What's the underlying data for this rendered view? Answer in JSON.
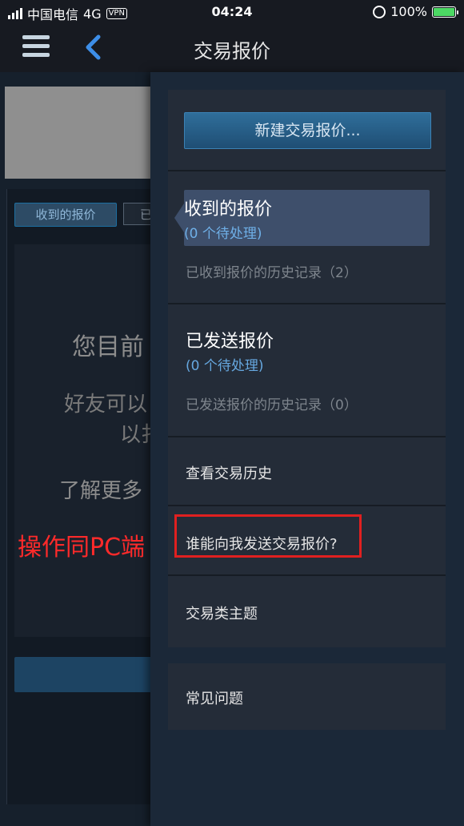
{
  "status_bar": {
    "carrier": "中国电信",
    "network": "4G",
    "vpn": "VPN",
    "time": "04:24",
    "battery_percent": "100%",
    "battery_level": 1.0,
    "battery_color": "#4cd964"
  },
  "header": {
    "title": "交易报价",
    "menu_icon": "hamburger-menu-icon",
    "back_icon": "chevron-left-icon",
    "back_color": "#3d8ee8"
  },
  "background_page": {
    "tab_received": "收到的报价",
    "tab_sent": "已",
    "text_line1": "您目前",
    "text_line2": "好友可以",
    "text_line3": "以扌",
    "text_line4": "了解更多"
  },
  "drawer": {
    "new_offer_button": "新建交易报价...",
    "received": {
      "title": "收到的报价",
      "pending": "(0 个待处理)",
      "history": "已收到报价的历史记录（2）"
    },
    "sent": {
      "title": "已发送报价",
      "pending": "(0 个待处理)",
      "history": "已发送报价的历史记录（0）"
    },
    "view_history": "查看交易历史",
    "who_can_send": "谁能向我发送交易报价?",
    "trade_topics": "交易类主题",
    "faq": "常见问题"
  },
  "annotation": {
    "text": "操作同PC端",
    "color": "#ff2a2a"
  }
}
